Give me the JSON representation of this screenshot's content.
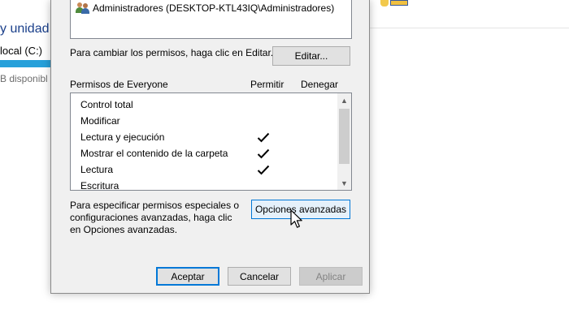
{
  "background": {
    "devices_heading": "y unidad",
    "drive_label": "local (C:)",
    "drive_free_text": "B disponibl",
    "drive_usage_fraction": 0.7
  },
  "dialog": {
    "groups_list": {
      "visible_item": "Administradores (DESKTOP-KTL43IQ\\Administradores)"
    },
    "edit_prompt": "Para cambiar los permisos, haga clic en Editar.",
    "edit_button": "Editar...",
    "permissions_header": {
      "title": "Permisos de Everyone",
      "allow": "Permitir",
      "deny": "Denegar"
    },
    "permissions": [
      {
        "name": "Control total",
        "allow": false,
        "deny": false
      },
      {
        "name": "Modificar",
        "allow": false,
        "deny": false
      },
      {
        "name": "Lectura y ejecución",
        "allow": true,
        "deny": false
      },
      {
        "name": "Mostrar el contenido de la carpeta",
        "allow": true,
        "deny": false
      },
      {
        "name": "Lectura",
        "allow": true,
        "deny": false
      },
      {
        "name": "Escritura",
        "allow": false,
        "deny": false
      }
    ],
    "advanced_prompt": {
      "line1": "Para especificar permisos especiales o",
      "line2": "configuraciones avanzadas, haga clic",
      "line3": "en Opciones avanzadas."
    },
    "advanced_button": "Opciones avanzadas",
    "footer": {
      "ok": "Aceptar",
      "cancel": "Cancelar",
      "apply": "Aplicar"
    }
  },
  "icons": {
    "group": "users-group-icon",
    "check": "checkmark-icon",
    "scroll_up": "scroll-up-arrow-icon",
    "scroll_down": "scroll-down-arrow-icon",
    "cursor": "mouse-pointer-icon"
  },
  "colors": {
    "accent": "#0078d7",
    "dialog_bg": "#f0f0f0",
    "drive_bar": "#26a0da"
  }
}
